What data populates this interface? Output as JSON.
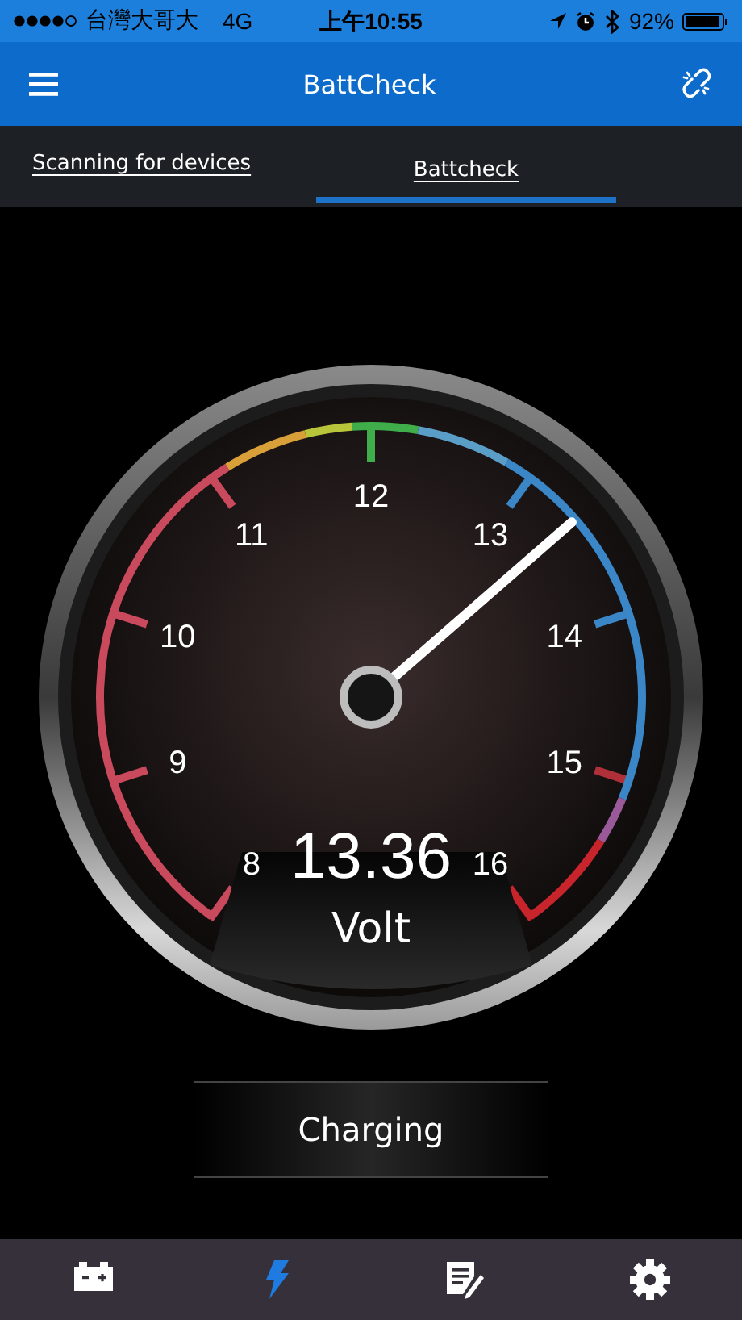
{
  "status_bar": {
    "carrier": "台灣大哥大",
    "network": "4G",
    "time": "上午10:55",
    "battery": "92%"
  },
  "app_bar": {
    "title": "BattCheck"
  },
  "tabs": [
    {
      "label": "Scanning for devices",
      "selected": false
    },
    {
      "label": "Battcheck",
      "selected": true
    }
  ],
  "gauge": {
    "scale": [
      "8",
      "9",
      "10",
      "11",
      "12",
      "13",
      "14",
      "15",
      "16"
    ],
    "level": 0.67,
    "reading": "13.36",
    "unit": "Volt"
  },
  "status_button": {
    "label": "Charging"
  },
  "bottom_nav": [
    {
      "kind": "battery",
      "selected": false
    },
    {
      "kind": "charge",
      "selected": true
    },
    {
      "kind": "report",
      "selected": false
    },
    {
      "kind": "settings",
      "selected": false
    }
  ]
}
